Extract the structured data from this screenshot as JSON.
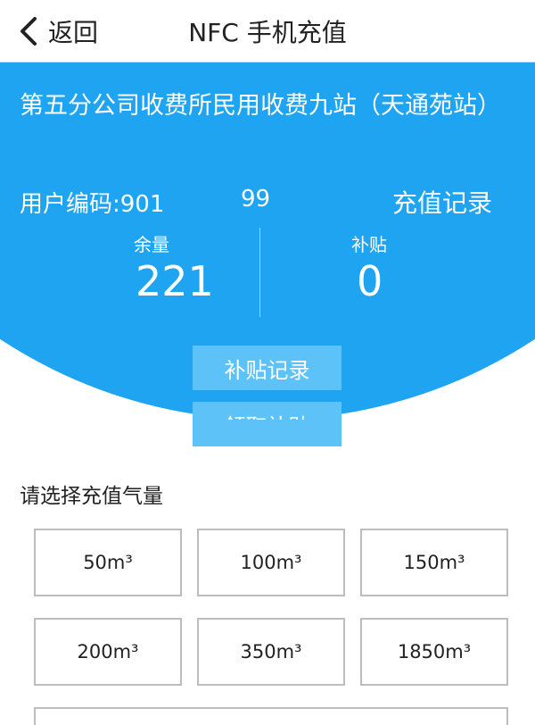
{
  "header": {
    "back_label": "返回",
    "title": "NFC 手机充值"
  },
  "account": {
    "station_name": "第五分公司收费所民用收费九站（天通苑站）",
    "user_code_label": "用户编码:901",
    "user_code_tail": "99",
    "recharge_record_label": "充值记录",
    "balance_label": "余量",
    "balance_value": "221",
    "subsidy_label": "补贴",
    "subsidy_value": "0",
    "subsidy_record_button": "补贴记录",
    "claim_subsidy_button": "领取补贴"
  },
  "recharge": {
    "prompt": "请选择充值气量",
    "options": [
      "50m³",
      "100m³",
      "150m³",
      "200m³",
      "350m³",
      "1850m³"
    ]
  },
  "colors": {
    "accent": "#1ea4f1",
    "button": "#5cc2f7"
  },
  "icons": {
    "back": "chevron-left-icon"
  }
}
